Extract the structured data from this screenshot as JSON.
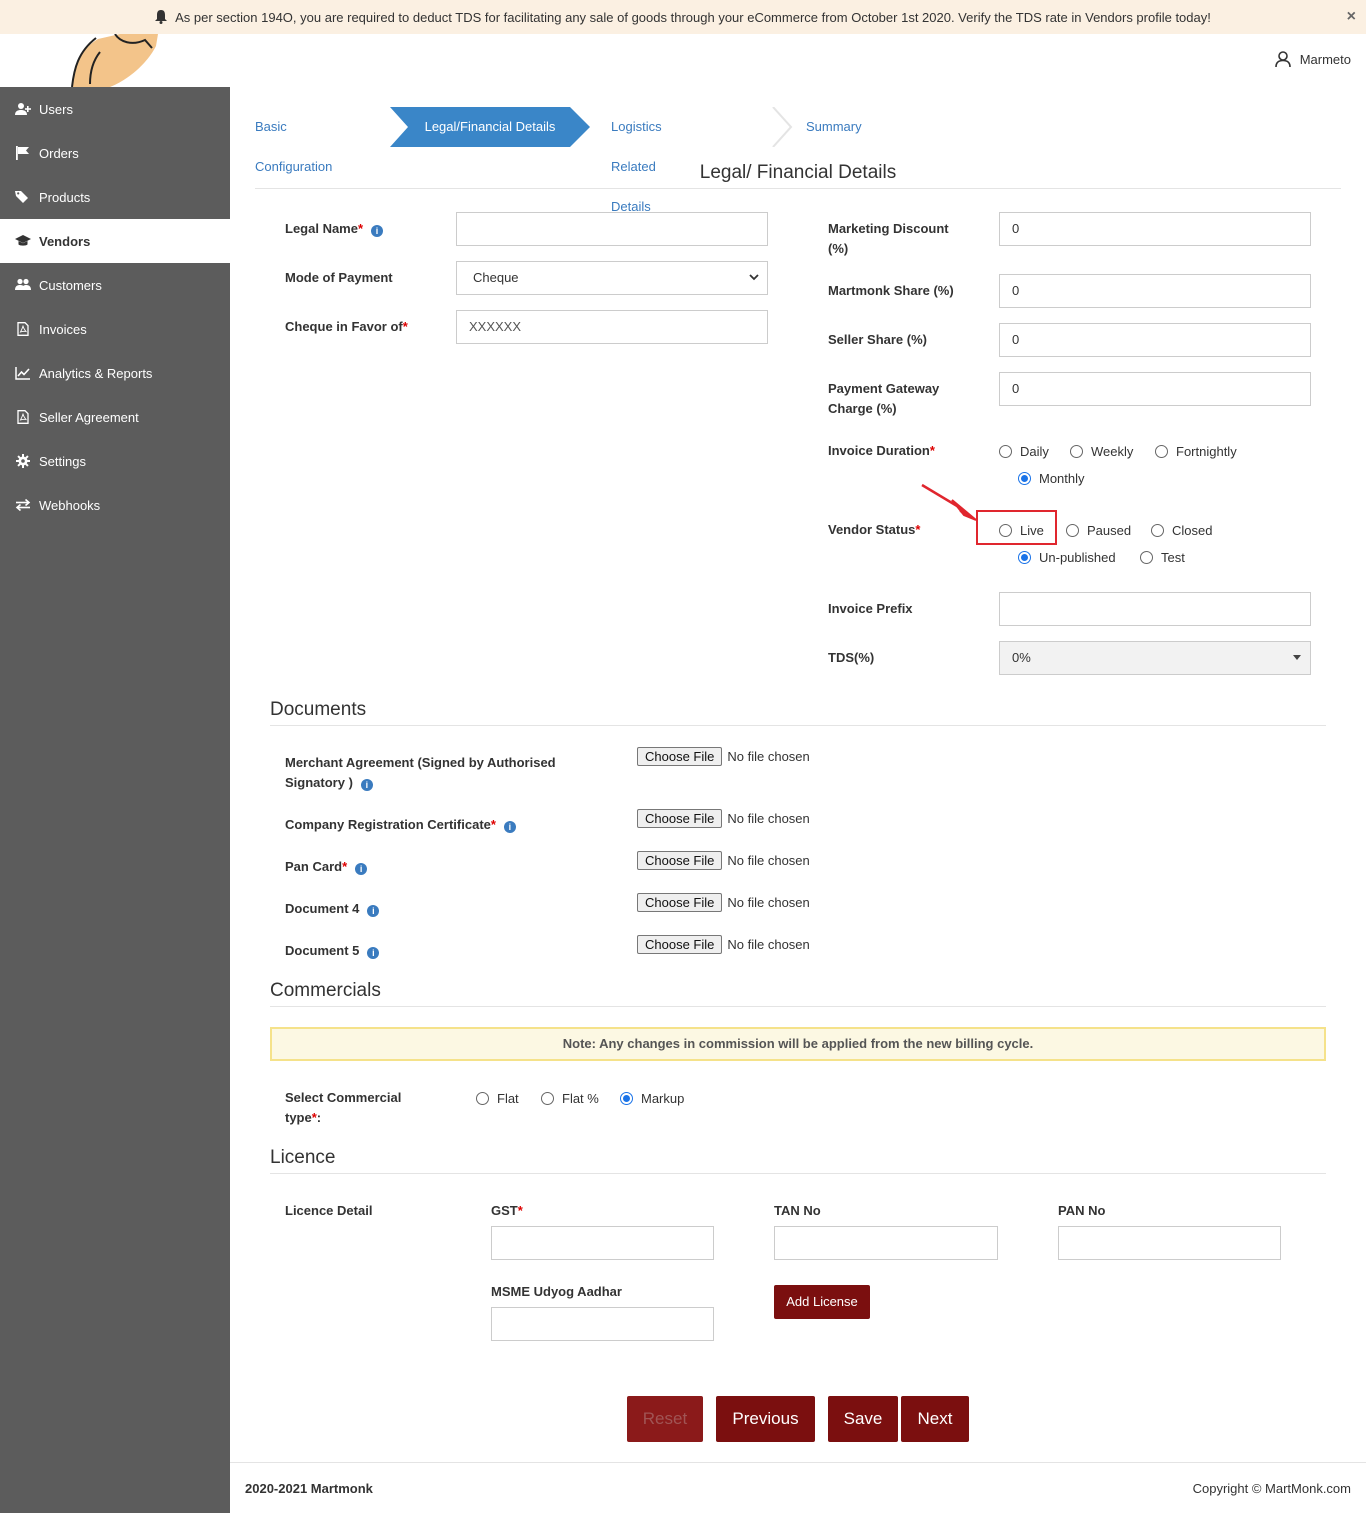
{
  "banner": {
    "text": "As per section 194O, you are required to deduct TDS for facilitating any sale of goods through your eCommerce from October 1st 2020. Verify the TDS rate in Vendors profile today!",
    "close": "×"
  },
  "header": {
    "username": "Marmeto"
  },
  "sidebar": {
    "items": [
      {
        "label": "Users",
        "icon": "user-plus-icon"
      },
      {
        "label": "Orders",
        "icon": "flag-icon"
      },
      {
        "label": "Products",
        "icon": "tags-icon"
      },
      {
        "label": "Vendors",
        "icon": "graduation-cap-icon",
        "active": true
      },
      {
        "label": "Customers",
        "icon": "users-icon"
      },
      {
        "label": "Invoices",
        "icon": "pdf-file-icon"
      },
      {
        "label": "Analytics & Reports",
        "icon": "line-chart-icon"
      },
      {
        "label": "Seller Agreement",
        "icon": "pdf-file-icon"
      },
      {
        "label": "Settings",
        "icon": "gear-icon"
      },
      {
        "label": "Webhooks",
        "icon": "exchange-icon"
      }
    ]
  },
  "steps": [
    "Basic Configuration",
    "Legal/Financial Details",
    "Logistics Related Details",
    "Summary"
  ],
  "section_title": "Legal/ Financial Details",
  "left_form": {
    "legal_name": {
      "label": "Legal Name",
      "value": ""
    },
    "mode_of_payment": {
      "label": "Mode of Payment",
      "value": "Cheque"
    },
    "cheque_in_favor": {
      "label": "Cheque in Favor of",
      "value": "XXXXXX"
    }
  },
  "right_form": {
    "marketing_discount": {
      "label": "Marketing Discount (%)",
      "value": "0"
    },
    "martmonk_share": {
      "label": "Martmonk Share (%)",
      "value": "0"
    },
    "seller_share": {
      "label": "Seller Share (%)",
      "value": "0"
    },
    "payment_gateway": {
      "label": "Payment Gateway Charge (%)",
      "value": "0"
    },
    "invoice_duration": {
      "label": "Invoice Duration",
      "options": [
        "Daily",
        "Weekly",
        "Fortnightly",
        "Monthly"
      ],
      "selected": "Monthly"
    },
    "vendor_status": {
      "label": "Vendor Status",
      "options": [
        "Live",
        "Paused",
        "Closed",
        "Un-published",
        "Test"
      ],
      "selected": "Un-published"
    },
    "invoice_prefix": {
      "label": "Invoice Prefix",
      "value": ""
    },
    "tds": {
      "label": "TDS(%)",
      "value": "0%"
    }
  },
  "documents": {
    "title": "Documents",
    "button_label": "Choose File",
    "status": "No file chosen",
    "items": [
      {
        "label": "Merchant Agreement (Signed by Authorised Signatory )",
        "required": false
      },
      {
        "label": "Company Registration Certificate",
        "required": true
      },
      {
        "label": "Pan Card",
        "required": true
      },
      {
        "label": "Document 4",
        "required": false
      },
      {
        "label": "Document 5",
        "required": false
      }
    ]
  },
  "commercials": {
    "title": "Commercials",
    "note": "Note: Any changes in commission will be applied from the new billing cycle.",
    "type_label": "Select Commercial type",
    "options": [
      "Flat",
      "Flat %",
      "Markup"
    ],
    "selected": "Markup"
  },
  "licence": {
    "title": "Licence",
    "detail_label": "Licence Detail",
    "gst_label": "GST",
    "tan_label": "TAN No",
    "pan_label": "PAN No",
    "msme_label": "MSME Udyog Aadhar",
    "add_button": "Add License"
  },
  "actions": {
    "reset": "Reset",
    "previous": "Previous",
    "save": "Save",
    "next": "Next"
  },
  "footer": {
    "left": "2020-2021 Martmonk",
    "right": "Copyright © MartMonk.com"
  },
  "colors": {
    "accent": "#3a7bbf",
    "sidebar": "#5c5c5c",
    "brand_button": "#7b0f0f",
    "highlight": "#e0262e"
  }
}
